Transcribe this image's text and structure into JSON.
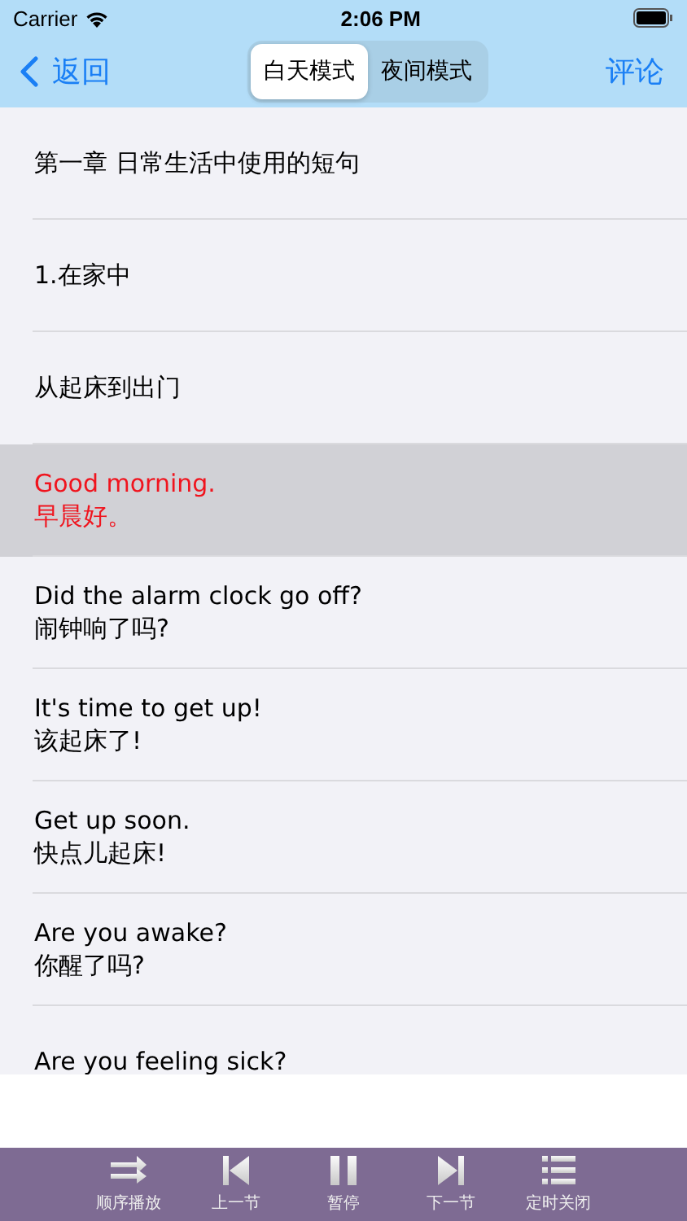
{
  "status_bar": {
    "carrier": "Carrier",
    "time": "2:06 PM"
  },
  "nav": {
    "back": "返回",
    "modes": [
      {
        "label": "白天模式",
        "selected": true
      },
      {
        "label": "夜间模式",
        "selected": false
      }
    ],
    "comment": "评论"
  },
  "rows": [
    {
      "lines": [
        "第一章 日常生活中使用的短句"
      ],
      "selected": false
    },
    {
      "lines": [
        "1.在家中"
      ],
      "selected": false
    },
    {
      "lines": [
        "从起床到出门"
      ],
      "selected": false
    },
    {
      "lines": [
        "Good morning.",
        "早晨好。"
      ],
      "selected": true
    },
    {
      "lines": [
        "Did the alarm clock go off?",
        "闹钟响了吗?"
      ],
      "selected": false
    },
    {
      "lines": [
        "It's time to get up!",
        "该起床了!"
      ],
      "selected": false
    },
    {
      "lines": [
        "Get up soon.",
        "快点儿起床!"
      ],
      "selected": false
    },
    {
      "lines": [
        "Are you awake?",
        "你醒了吗?"
      ],
      "selected": false
    },
    {
      "lines": [
        "Are you feeling sick?"
      ],
      "selected": false
    }
  ],
  "toolbar": [
    {
      "kind": "order",
      "label": "顺序播放"
    },
    {
      "kind": "prev",
      "label": "上一节"
    },
    {
      "kind": "pause",
      "label": "暂停"
    },
    {
      "kind": "next",
      "label": "下一节"
    },
    {
      "kind": "timer",
      "label": "定时关闭"
    }
  ]
}
